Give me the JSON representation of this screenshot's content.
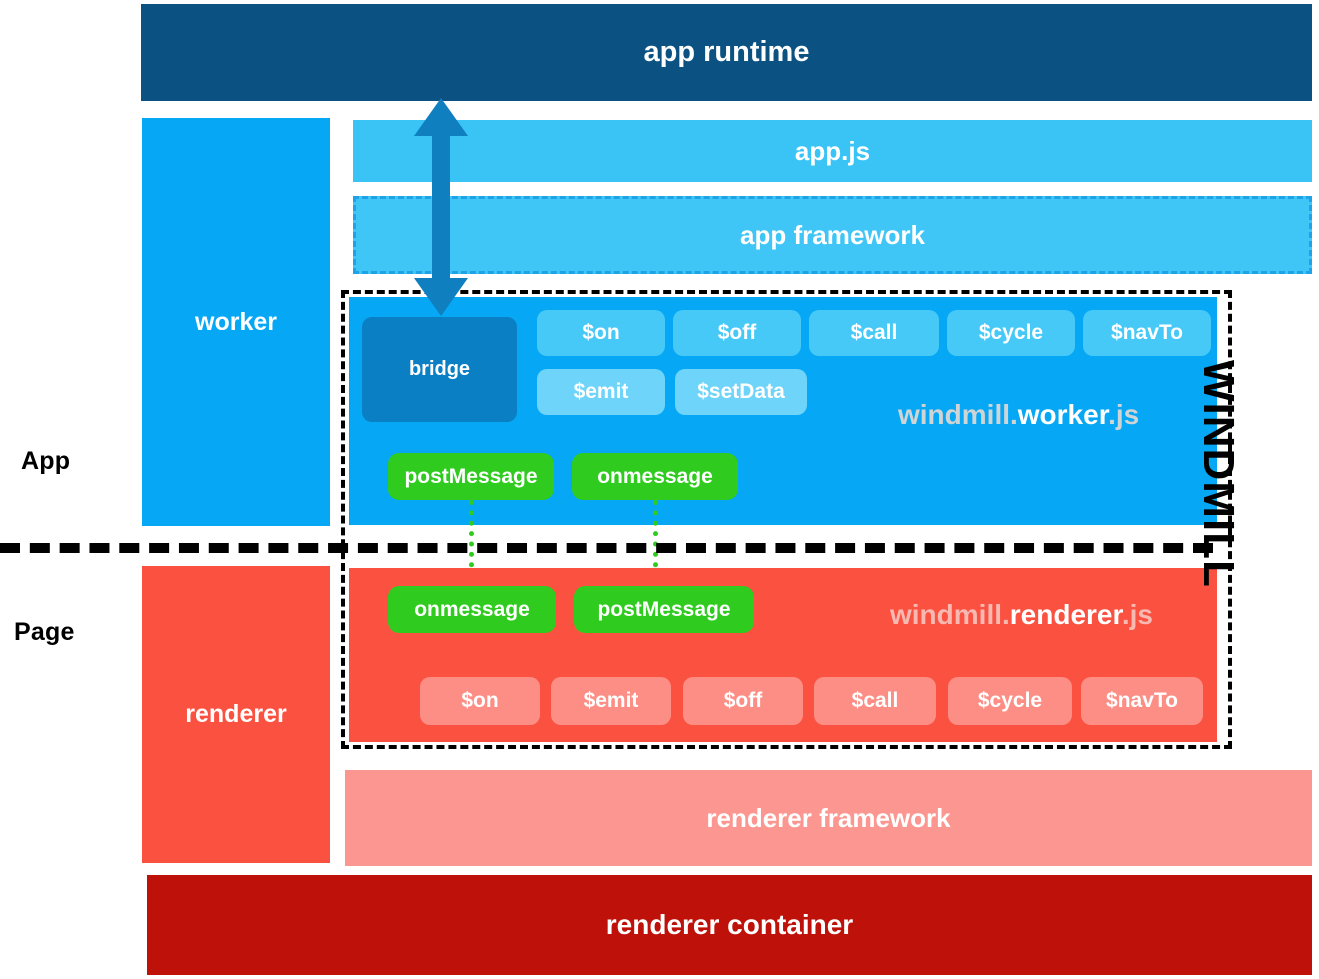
{
  "title": "windmill worker / renderer architecture",
  "colors": {
    "app_runtime": "#0b5182",
    "app_js": "#39c4f5",
    "app_framework": "#3fc6f6",
    "worker": "#06a7f5",
    "worker_button": "#47c9f7",
    "bridge": "#0a7fc4",
    "renderer": "#fb5140",
    "renderer_button": "#fd8e85",
    "renderer_framework": "#fb9790",
    "renderer_container": "#be1109",
    "message_green": "#2fcc1f",
    "arrow_blue": "#0f7fc0",
    "boundary_black": "#000000"
  },
  "layers": {
    "app_runtime": "app runtime",
    "app_js": "app.js",
    "app_framework": "app framework",
    "renderer_framework": "renderer framework",
    "renderer_container": "renderer container"
  },
  "side_labels": {
    "app": "App",
    "page": "Page"
  },
  "columns": {
    "worker": "worker",
    "renderer": "renderer"
  },
  "boundary": {
    "label": "WINDMILL"
  },
  "worker": {
    "bridge": "bridge",
    "lib_prefix": "windmill.",
    "lib_name": "worker",
    "lib_suffix": ".js",
    "api_row1": [
      "$on",
      "$off",
      "$call",
      "$cycle",
      "$navTo"
    ],
    "api_row2": [
      "$emit",
      "$setData"
    ],
    "messaging": [
      "postMessage",
      "onmessage"
    ]
  },
  "renderer": {
    "lib_prefix": "windmill.",
    "lib_name": "renderer",
    "lib_suffix": ".js",
    "messaging": [
      "onmessage",
      "postMessage"
    ],
    "api_row": [
      "$on",
      "$emit",
      "$off",
      "$call",
      "$cycle",
      "$navTo"
    ]
  }
}
